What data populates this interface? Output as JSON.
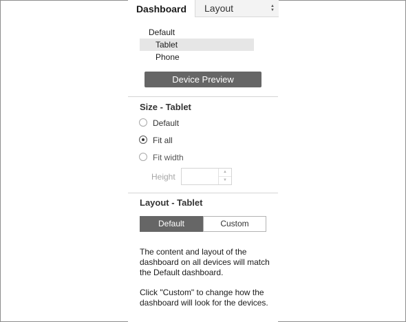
{
  "tabs": {
    "dashboard": "Dashboard",
    "layout": "Layout",
    "layout_arrows": "▲▼"
  },
  "devices": {
    "default": "Default",
    "tablet": "Tablet",
    "phone": "Phone",
    "selected": "Tablet"
  },
  "preview_button": "Device Preview",
  "size_section": {
    "title": "Size - Tablet",
    "options": [
      {
        "label": "Default",
        "checked": false
      },
      {
        "label": "Fit all",
        "checked": true
      },
      {
        "label": "Fit width",
        "checked": false
      }
    ],
    "height_label": "Height",
    "height_value": ""
  },
  "layout_section": {
    "title": "Layout - Tablet",
    "default_label": "Default",
    "custom_label": "Custom",
    "selected": "Default",
    "description_1": "The content and layout of the dashboard on all devices will match the Default dashboard.",
    "description_2": "Click \"Custom\" to change how the dashboard will look for the devices."
  },
  "colors": {
    "button_dark": "#666666",
    "selected_row": "#e6e6e6",
    "divider": "#d4d4d4"
  }
}
